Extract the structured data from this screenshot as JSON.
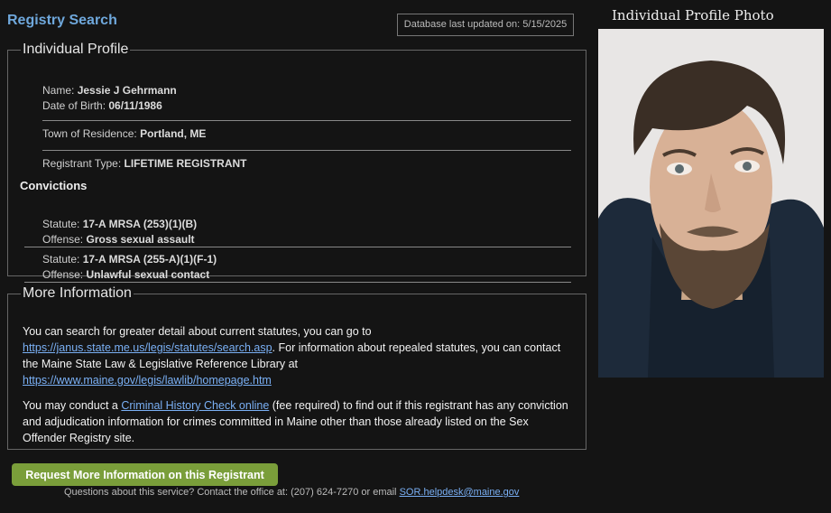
{
  "header": {
    "title": "Registry Search",
    "db_updated": "Database last updated on: 5/15/2025"
  },
  "profile": {
    "legend": "Individual Profile",
    "name_label": "Name: ",
    "name": "Jessie J Gehrmann",
    "dob_label": "Date of Birth: ",
    "dob": "06/11/1986",
    "town_label": "Town of Residence: ",
    "town": "Portland, ME",
    "type_label": "Registrant Type: ",
    "type": "LIFETIME REGISTRANT"
  },
  "convictions": {
    "title": "Convictions",
    "statute_label": "Statute: ",
    "offense_label": "Offense: ",
    "items": [
      {
        "statute": "17-A MRSA (253)(1)(B)",
        "offense": "Gross sexual assault"
      },
      {
        "statute": "17-A MRSA (255-A)(1)(F-1)",
        "offense": "Unlawful sexual contact"
      }
    ]
  },
  "more": {
    "legend": "More Information",
    "p1_a": "You can search for greater detail about current statutes, you can go to",
    "link1": "https://janus.state.me.us/legis/statutes/search.asp",
    "p1_b": ". For information about repealed statutes, you can contact the Maine State Law & Legislative Reference Library at",
    "link2": "https://www.maine.gov/legis/lawlib/homepage.htm",
    "p2_a": "You may conduct a ",
    "link3": "Criminal History Check online",
    "p2_b": " (fee required) to find out if this registrant has any conviction and adjudication information for crimes committed in Maine other than those already listed on the Sex Offender Registry site."
  },
  "photo": {
    "title": "Individual Profile Photo"
  },
  "actions": {
    "request_label": "Request More Information on this Registrant"
  },
  "footer": {
    "text": "Questions about this service? Contact the office at: (207) 624-7270 or email ",
    "email": "SOR.helpdesk@maine.gov"
  }
}
